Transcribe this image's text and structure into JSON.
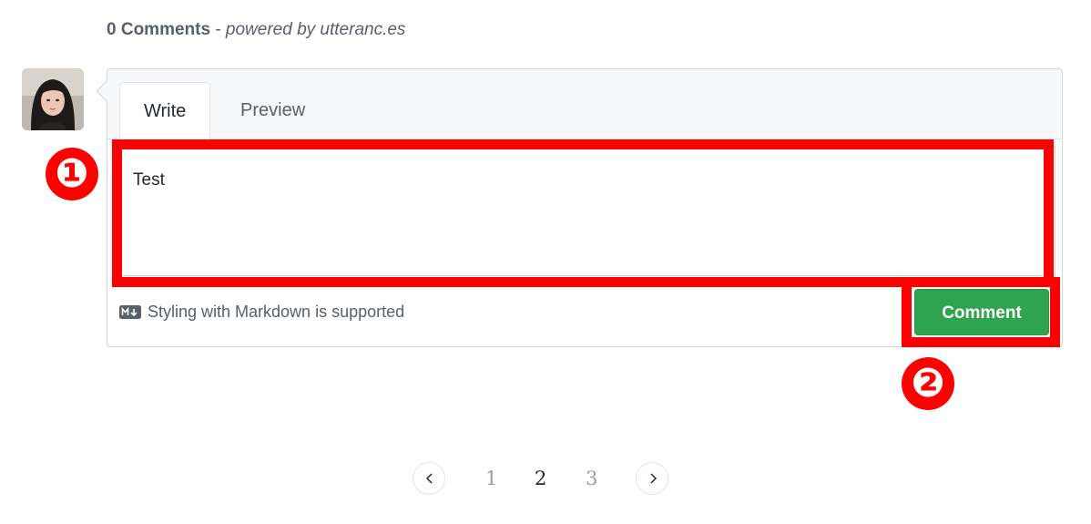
{
  "header": {
    "count_label": "0 Comments",
    "separator": "-",
    "powered_by": "powered by utteranc.es"
  },
  "editor": {
    "tabs": [
      {
        "label": "Write",
        "active": true
      },
      {
        "label": "Preview",
        "active": false
      }
    ],
    "text_value": "Test",
    "markdown_hint": "Styling with Markdown is supported",
    "submit_label": "Comment"
  },
  "annotations": {
    "marker_1": "❶",
    "marker_2": "❷",
    "highlight_color": "#ff0000"
  },
  "pagination": {
    "pages": [
      "1",
      "2",
      "3"
    ],
    "current": "2"
  },
  "colors": {
    "button_green": "#2ea44f",
    "annotation_red": "#ff0000",
    "muted_text": "#586069"
  },
  "icons": {
    "avatar": "user-avatar",
    "markdown": "markdown-icon",
    "prev": "chevron-left-icon",
    "next": "chevron-right-icon"
  }
}
